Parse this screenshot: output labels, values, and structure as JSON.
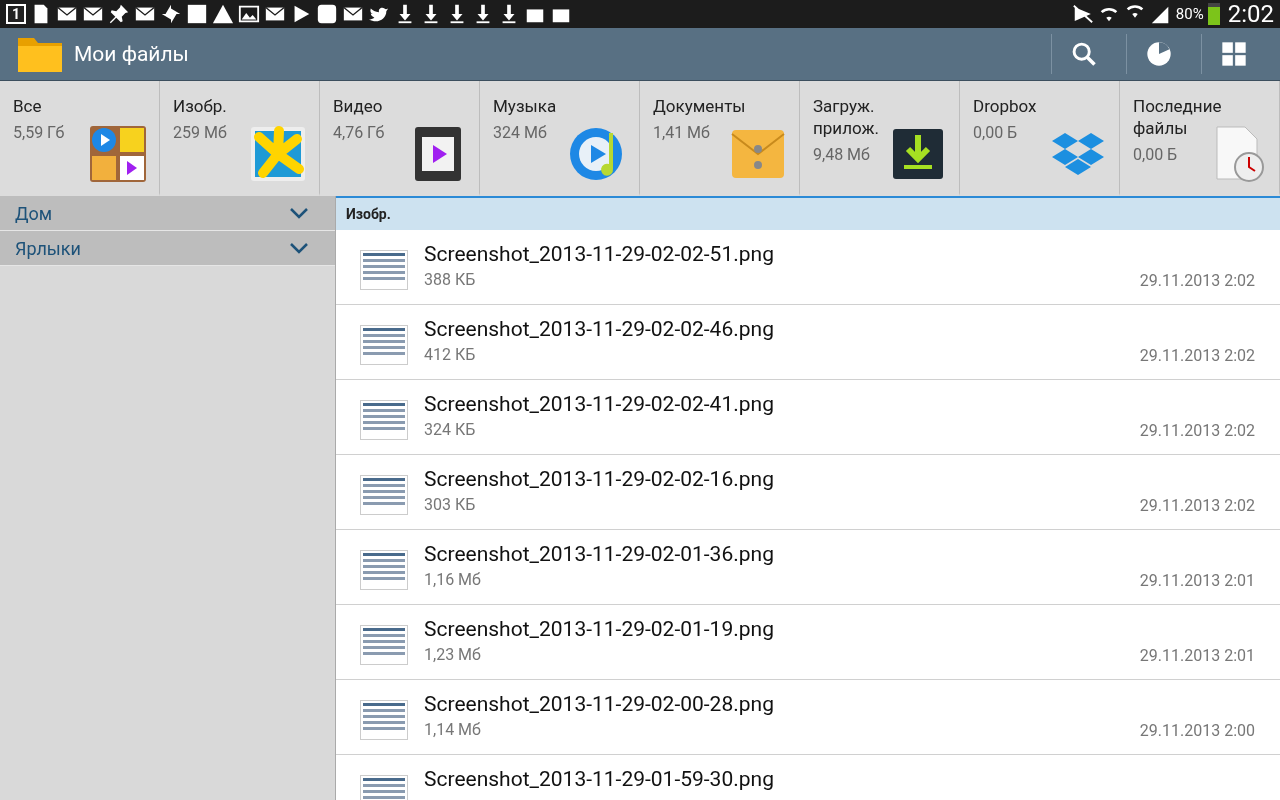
{
  "status_bar": {
    "calendar_day": "1",
    "battery_percent": "80%",
    "time": "2:02"
  },
  "action_bar": {
    "title": "Мои файлы"
  },
  "categories": [
    {
      "kind": "all",
      "label": "Все",
      "size": "5,59 Гб"
    },
    {
      "kind": "image",
      "label": "Изобр.",
      "size": "259 Мб"
    },
    {
      "kind": "video",
      "label": "Видео",
      "size": "4,76 Гб"
    },
    {
      "kind": "music",
      "label": "Музыка",
      "size": "324 Мб"
    },
    {
      "kind": "document",
      "label": "Документы",
      "size": "1,41 Мб"
    },
    {
      "kind": "download",
      "label": "Загруж. прилож.",
      "size": "9,48 Мб"
    },
    {
      "kind": "dropbox",
      "label": "Dropbox",
      "size": "0,00 Б"
    },
    {
      "kind": "recent",
      "label": "Последние файлы",
      "size": "0,00 Б"
    }
  ],
  "sidebar": {
    "items": [
      {
        "label": "Дом",
        "expanded": false
      },
      {
        "label": "Ярлыки",
        "expanded": false
      }
    ]
  },
  "file_list": {
    "header": "Изобр.",
    "rows": [
      {
        "name": "Screenshot_2013-11-29-02-02-51.png",
        "size": "388 КБ",
        "date": "29.11.2013 2:02"
      },
      {
        "name": "Screenshot_2013-11-29-02-02-46.png",
        "size": "412 КБ",
        "date": "29.11.2013 2:02"
      },
      {
        "name": "Screenshot_2013-11-29-02-02-41.png",
        "size": "324 КБ",
        "date": "29.11.2013 2:02"
      },
      {
        "name": "Screenshot_2013-11-29-02-02-16.png",
        "size": "303 КБ",
        "date": "29.11.2013 2:02"
      },
      {
        "name": "Screenshot_2013-11-29-02-01-36.png",
        "size": "1,16 Мб",
        "date": "29.11.2013 2:01"
      },
      {
        "name": "Screenshot_2013-11-29-02-01-19.png",
        "size": "1,23 Мб",
        "date": "29.11.2013 2:01"
      },
      {
        "name": "Screenshot_2013-11-29-02-00-28.png",
        "size": "1,14 Мб",
        "date": "29.11.2013 2:00"
      },
      {
        "name": "Screenshot_2013-11-29-01-59-30.png"
      }
    ]
  }
}
